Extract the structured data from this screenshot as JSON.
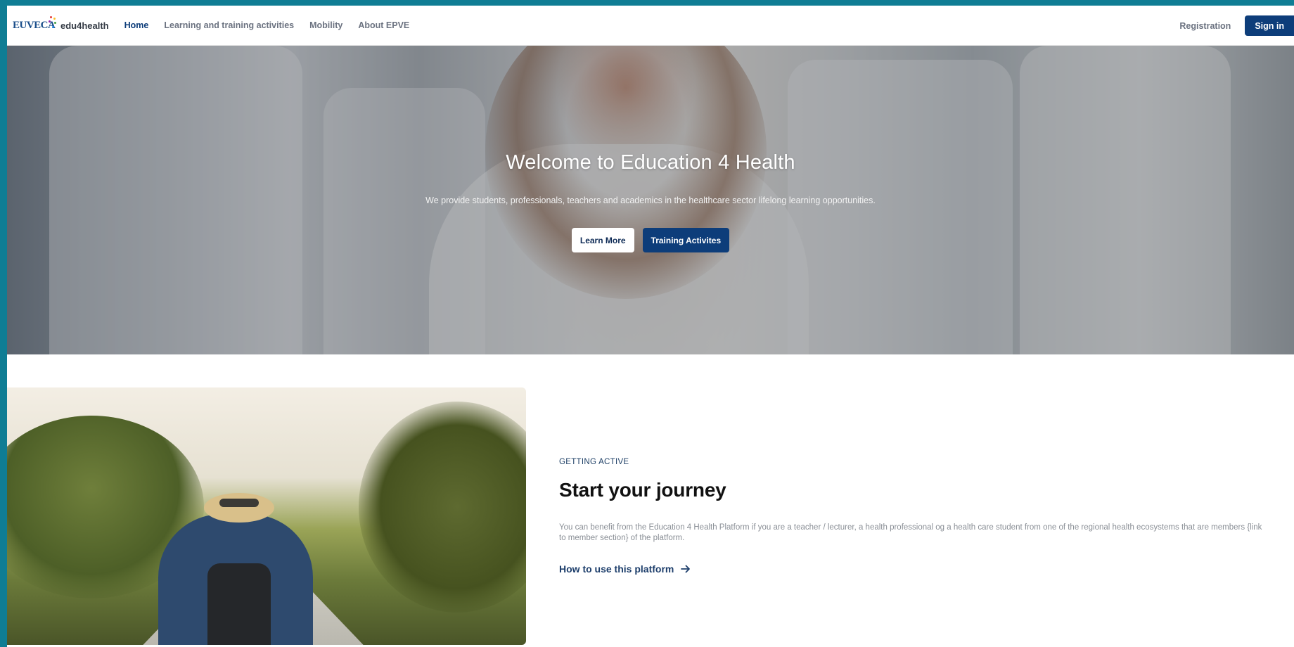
{
  "brand": {
    "logo_text": "EUVECA",
    "name": "edu4health"
  },
  "nav": {
    "links": [
      {
        "label": "Home",
        "active": true
      },
      {
        "label": "Learning and training activities",
        "active": false
      },
      {
        "label": "Mobility",
        "active": false
      },
      {
        "label": "About EPVE",
        "active": false
      }
    ],
    "registration": "Registration",
    "sign_in": "Sign in"
  },
  "hero": {
    "title": "Welcome to Education 4 Health",
    "subtitle": "We provide students, professionals, teachers and academics in the healthcare sector lifelong learning opportunities.",
    "learn_more": "Learn More",
    "training": "Training Activites"
  },
  "journey": {
    "eyebrow": "GETTING ACTIVE",
    "title": "Start your journey",
    "body": "You can benefit from the Education 4 Health Platform if you are a teacher / lecturer, a health professional og a health care student from one of the regional health ecosystems that are members {link to member section} of the platform.",
    "cta": "How to use this platform"
  },
  "colors": {
    "primary": "#0d3d7a",
    "frame": "#0f7d94",
    "body_text": "#8a8f96"
  }
}
